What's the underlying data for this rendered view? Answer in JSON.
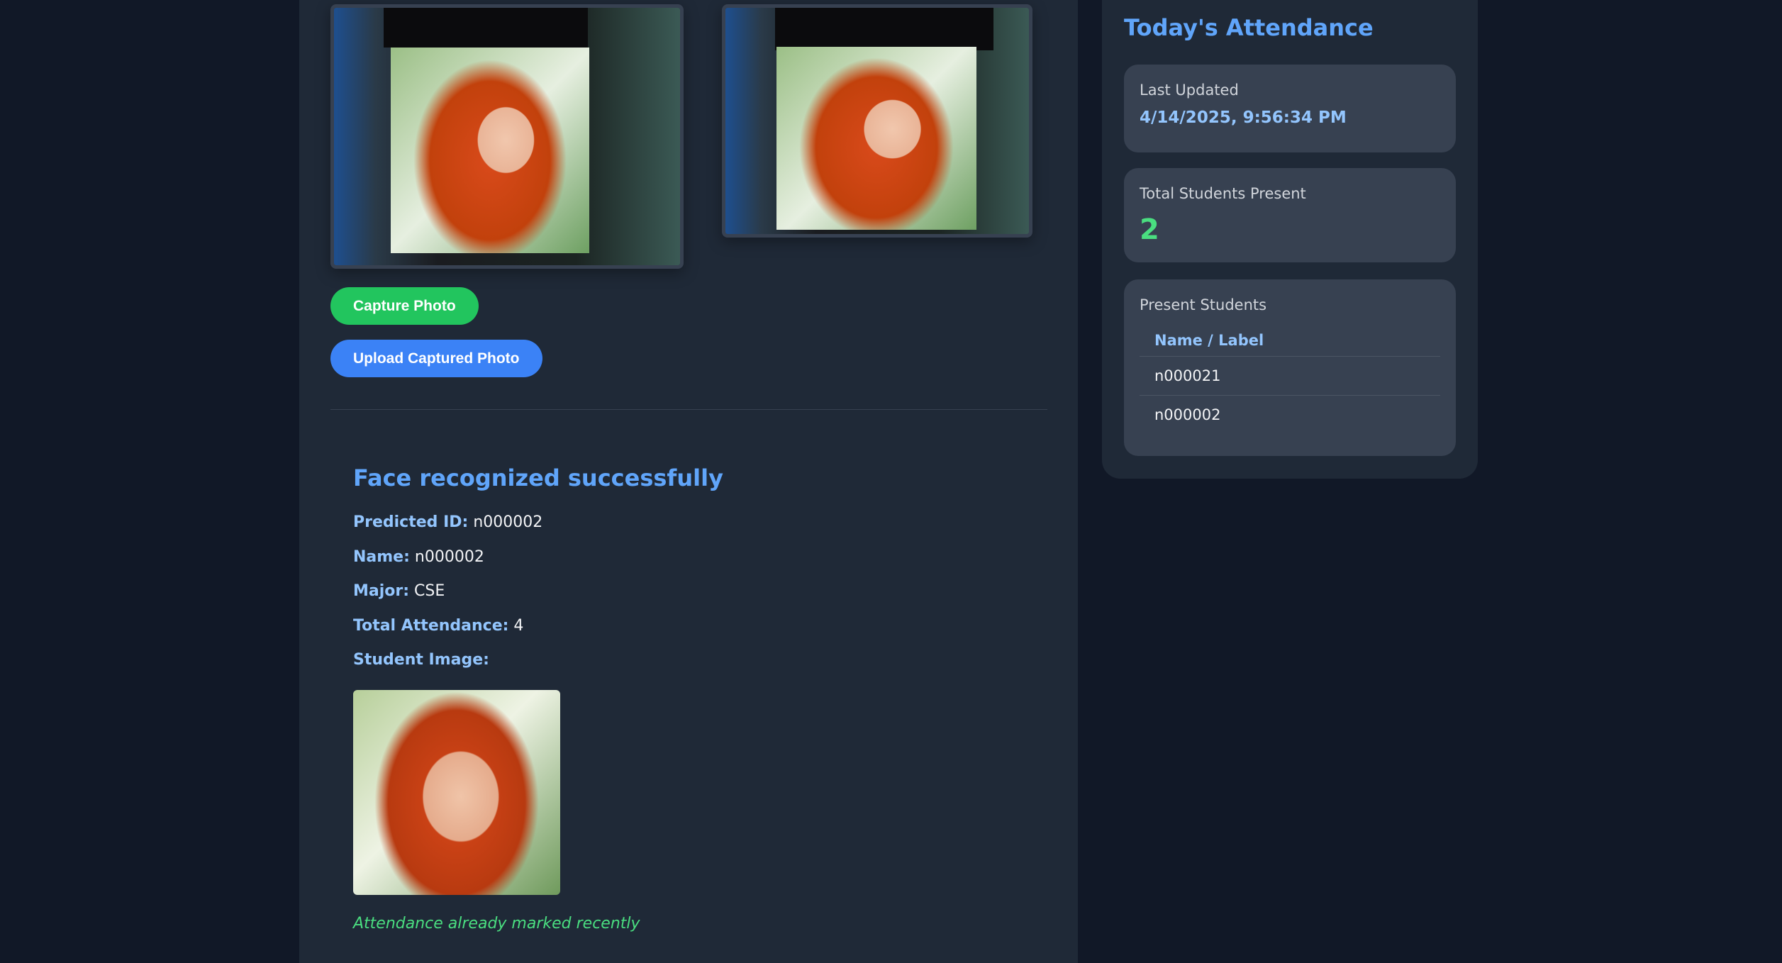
{
  "capture": {
    "capture_button": "Capture Photo",
    "upload_button": "Upload Captured Photo",
    "capture_color": "#22c55e",
    "upload_color": "#3b82f6"
  },
  "result": {
    "title": "Face recognized successfully",
    "predicted_id_label": "Predicted ID:",
    "predicted_id": "n000002",
    "name_label": "Name:",
    "name": "n000002",
    "major_label": "Major:",
    "major": "CSE",
    "attendance_label": "Total Attendance:",
    "attendance": "4",
    "image_label": "Student Image:",
    "note": "Attendance already marked recently"
  },
  "sidebar": {
    "title": "Today's Attendance",
    "last_updated_label": "Last Updated",
    "last_updated": "4/14/2025, 9:56:34 PM",
    "total_label": "Total Students Present",
    "total": "2",
    "present_label": "Present Students",
    "column_header": "Name / Label",
    "students": [
      "n000021",
      "n000002"
    ]
  }
}
